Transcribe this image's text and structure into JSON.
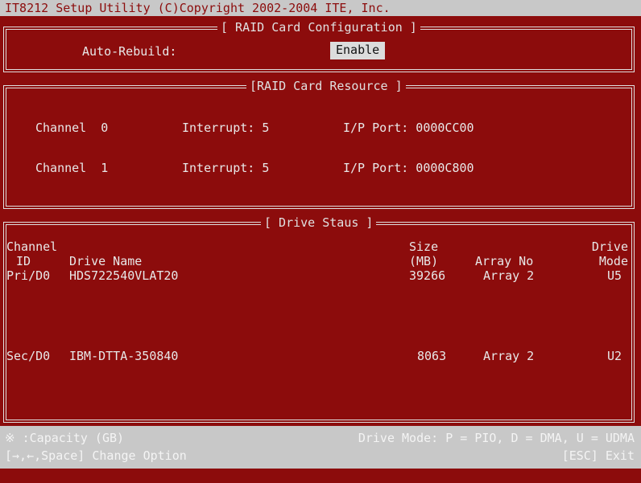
{
  "header": {
    "title": "IT8212 Setup Utility (C)Copyright 2002-2004 ITE, Inc."
  },
  "config": {
    "title": "[ RAID Card Configuration ]",
    "label": "Auto-Rebuild:",
    "value": "Enable"
  },
  "resource": {
    "title": "[RAID Card Resource ]",
    "rows": [
      {
        "channel": "Channel  0",
        "interrupt": "Interrupt: 5",
        "port": "I/P Port: 0000CC00"
      },
      {
        "channel": "Channel  1",
        "interrupt": "Interrupt: 5",
        "port": "I/P Port: 0000C800"
      }
    ]
  },
  "drives": {
    "title": "[ Drive Staus ]",
    "headers": {
      "channel_l1": "Channel",
      "channel_l2": "ID",
      "name": "Drive Name",
      "size_l1": "Size",
      "size_l2": "(MB)",
      "array": "Array No",
      "mode_l1": "Drive",
      "mode_l2": "Mode"
    },
    "rows": [
      {
        "channel": "Pri/D0",
        "name": "HDS722540VLAT20",
        "size": "39266",
        "array": "Array 2",
        "mode": "U5"
      },
      {
        "channel": "Sec/D0",
        "name": "IBM-DTTA-350840",
        "size": "8063",
        "array": "Array 2",
        "mode": "U2"
      }
    ]
  },
  "footer": {
    "capacity": "※ :Capacity (GB)",
    "mode_legend": "Drive Mode: P = PIO, D = DMA, U = UDMA",
    "keys": "[→,←,Space] Change Option",
    "exit": "[ESC] Exit"
  }
}
